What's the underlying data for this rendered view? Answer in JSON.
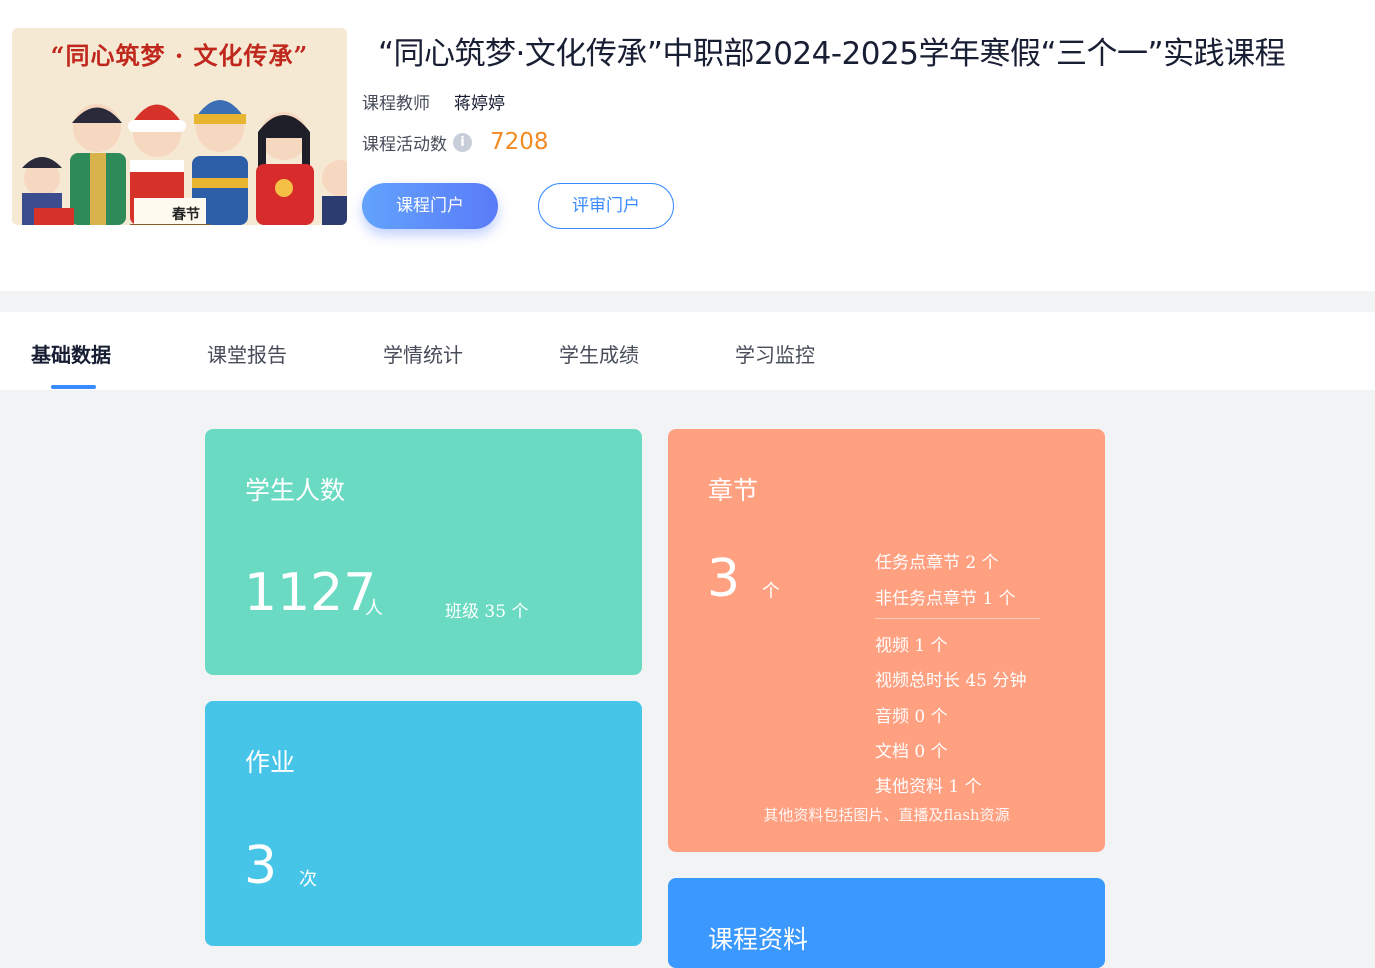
{
  "course": {
    "cover": {
      "caption": "“同心筑梦 · 文化传承”",
      "tag": "春节"
    },
    "title": "“同心筑梦·文化传承”中职部2024-2025学年寒假“三个一”实践课程",
    "teacher_label": "课程教师",
    "teacher_name": "蒋婷婷",
    "activity_label": "课程活动数",
    "activity_count": "7208",
    "portal_button": "课程门户",
    "review_button": "评审门户"
  },
  "tabs": [
    "基础数据",
    "课堂报告",
    "学情统计",
    "学生成绩",
    "学习监控"
  ],
  "cards": {
    "students": {
      "title": "学生人数",
      "count": "1127",
      "unit": "人",
      "class_info": "班级 35 个"
    },
    "homework": {
      "title": "作业",
      "count": "3",
      "unit": "次"
    },
    "chapters": {
      "title": "章节",
      "count": "3",
      "unit": "个",
      "task_chapters": "任务点章节 2 个",
      "non_task_chapters": "非任务点章节 1 个",
      "video": "视频 1 个",
      "video_duration": "视频总时长 45 分钟",
      "audio": "音频 0 个",
      "document": "文档 0 个",
      "other": "其他资料 1 个",
      "note": "其他资料包括图片、直播及flash资源"
    },
    "materials": {
      "title": "课程资料"
    }
  },
  "colors": {
    "students_card": "#6adbc2",
    "homework_card": "#47c5e8",
    "chapters_card": "#ffa081",
    "materials_card": "#3a98ff",
    "accent": "#3a8bff",
    "activity_count": "#f28b22"
  }
}
